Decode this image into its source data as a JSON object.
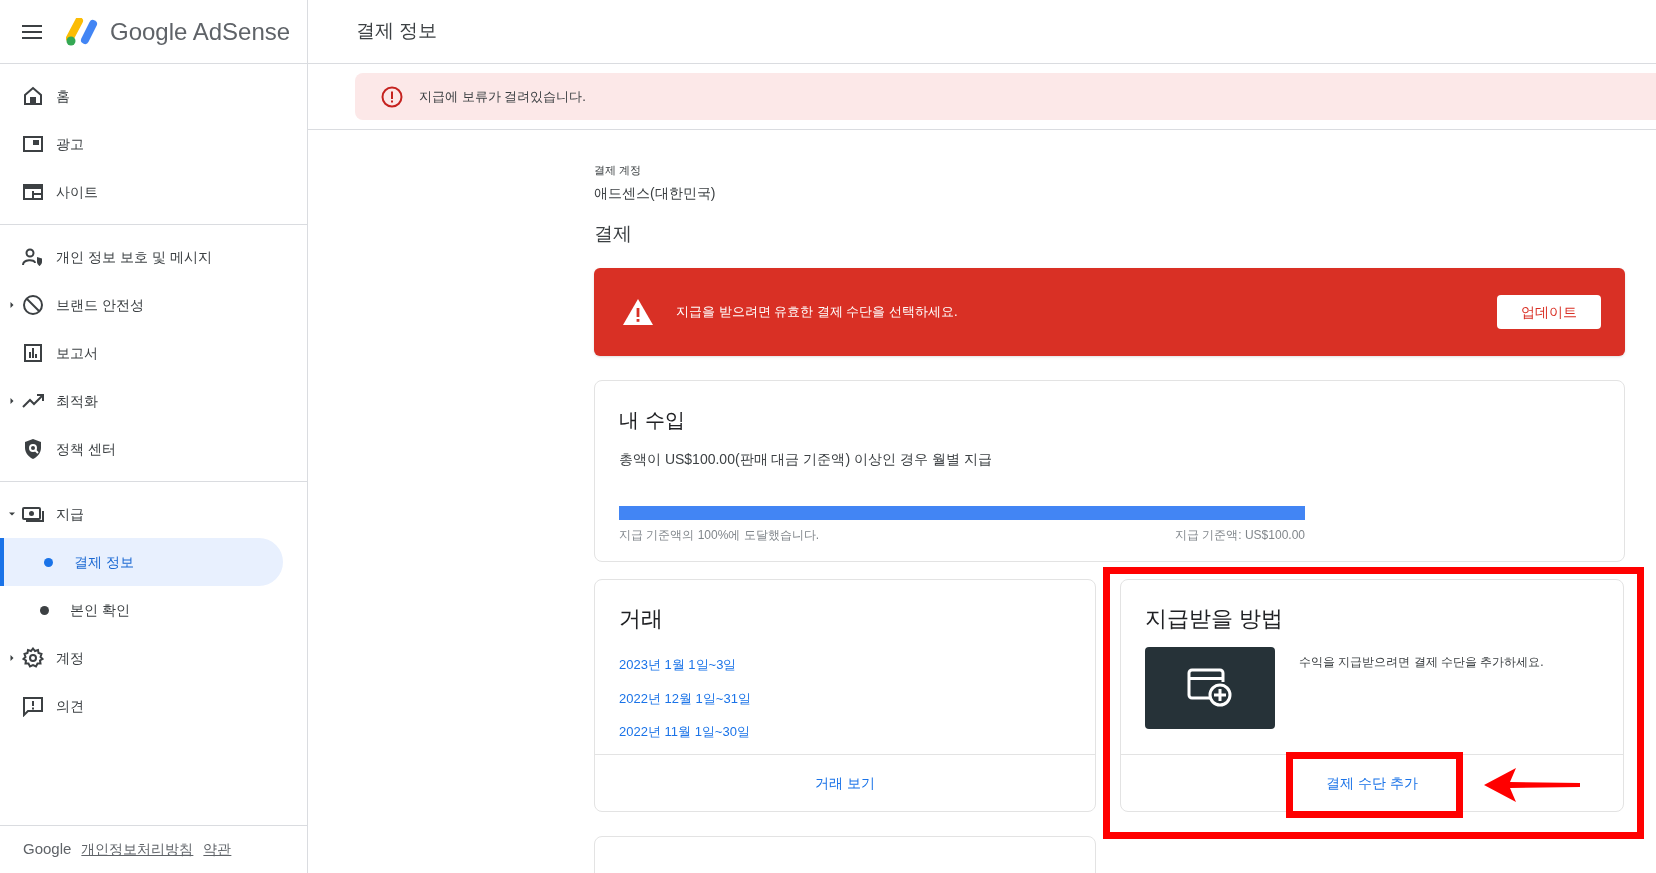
{
  "header": {
    "product": "Google AdSense",
    "page_title": "결제 정보"
  },
  "sidebar": {
    "sections": [
      {
        "items": [
          {
            "label": "홈",
            "selected": false
          },
          {
            "label": "광고",
            "selected": false
          },
          {
            "label": "사이트",
            "selected": false
          }
        ]
      },
      {
        "items": [
          {
            "label": "개인 정보 보호 및 메시지",
            "selected": false
          },
          {
            "label": "브랜드 안전성",
            "selected": false,
            "expanded": false
          },
          {
            "label": "보고서",
            "selected": false
          },
          {
            "label": "최적화",
            "selected": false,
            "expanded": false
          },
          {
            "label": "정책 센터",
            "selected": false
          }
        ]
      },
      {
        "items": [
          {
            "label": "지급",
            "selected": false,
            "expanded": true,
            "children": [
              {
                "label": "결제 정보",
                "selected": true
              },
              {
                "label": "본인 확인",
                "selected": false
              }
            ]
          },
          {
            "label": "계정",
            "selected": false,
            "expanded": false
          },
          {
            "label": "의견",
            "selected": false
          }
        ]
      }
    ],
    "footer": {
      "brand": "Google",
      "links": [
        "개인정보처리방침",
        "약관"
      ]
    }
  },
  "hold_notice": "지급에 보류가 걸려있습니다.",
  "payment_account": {
    "label": "결제 계정",
    "value": "애드센스(대한민국)"
  },
  "section_title": "결제",
  "error_banner": {
    "message": "지급을 받으려면 유효한 결제 수단을 선택하세요.",
    "button": "업데이트"
  },
  "earnings": {
    "title": "내 수입",
    "description": "총액이 US$100.00(판매 대금 기준액) 이상인 경우 월별 지급",
    "level": 1,
    "progress_text": "지급 기준액의 100%에 도달했습니다.",
    "threshold_text": "지급 기준액: US$100.00"
  },
  "transactions": {
    "title": "거래",
    "periods": [
      "2023년 1월 1일~3일",
      "2022년 12월 1일~31일",
      "2022년 11월 1일~30일"
    ],
    "action": "거래 보기"
  },
  "payment_method": {
    "title": "지급받을 방법",
    "message": "수익을 지급받으려면 결제 수단을 추가하세요.",
    "action": "결제 수단 추가"
  }
}
